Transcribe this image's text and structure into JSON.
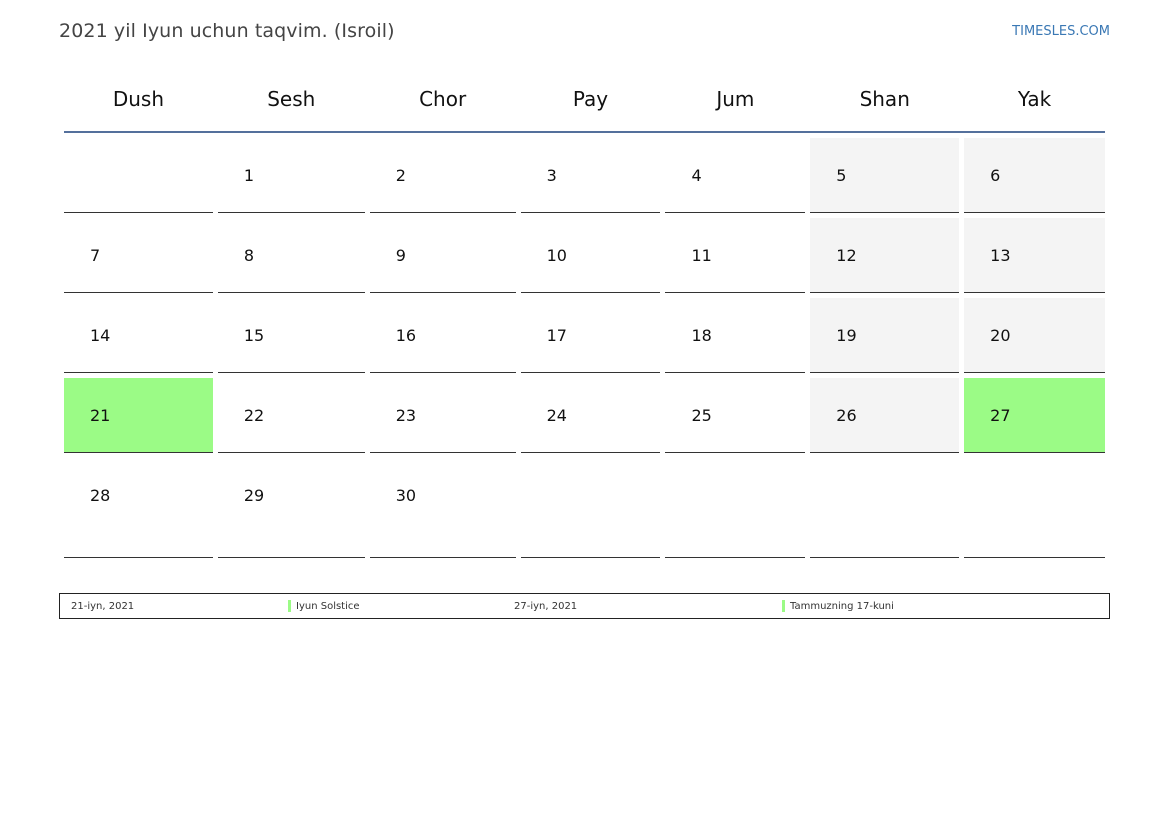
{
  "header": {
    "title": "2021 yil Iyun uchun taqvim. (Isroil)",
    "site": "TIMESLES.COM"
  },
  "weekdays": [
    "Dush",
    "Sesh",
    "Chor",
    "Pay",
    "Jum",
    "Shan",
    "Yak"
  ],
  "weeks": [
    [
      "",
      "1",
      "2",
      "3",
      "4",
      "5",
      "6"
    ],
    [
      "7",
      "8",
      "9",
      "10",
      "11",
      "12",
      "13"
    ],
    [
      "14",
      "15",
      "16",
      "17",
      "18",
      "19",
      "20"
    ],
    [
      "21",
      "22",
      "23",
      "24",
      "25",
      "26",
      "27"
    ],
    [
      "28",
      "29",
      "30",
      "",
      "",
      "",
      ""
    ]
  ],
  "holiday_days": [
    "21",
    "27"
  ],
  "colors": {
    "holiday": "#9bfb86",
    "weekend": "#f4f4f4",
    "header_rule": "#54709c"
  },
  "legend": [
    {
      "date": "21-iyn, 2021",
      "name": "Iyun Solstice"
    },
    {
      "date": "27-iyn, 2021",
      "name": "Tammuzning 17-kuni"
    }
  ]
}
